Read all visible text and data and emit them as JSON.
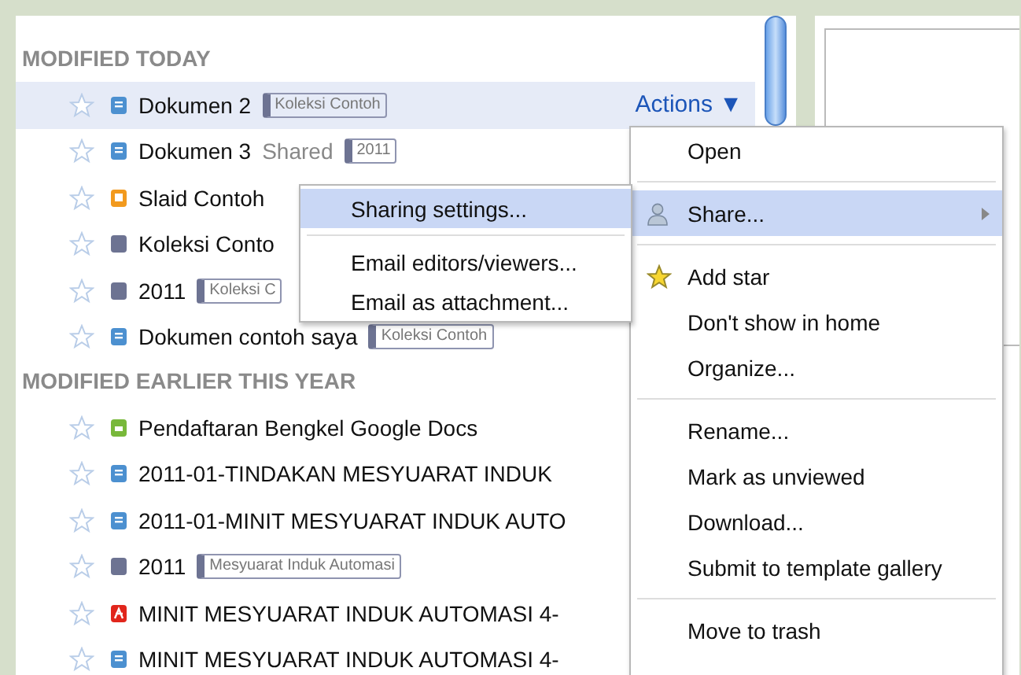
{
  "sections": [
    {
      "title": "MODIFIED TODAY",
      "rows": [
        {
          "name": "Dokumen 2",
          "kind": "document",
          "starred": false,
          "selected": true,
          "shared": "",
          "tags": [
            "Koleksi Contoh"
          ],
          "actions": "Actions ▼"
        },
        {
          "name": "Dokumen 3",
          "kind": "document",
          "starred": false,
          "selected": false,
          "shared": "Shared",
          "tags": [
            "2011"
          ]
        },
        {
          "name": "Slaid Contoh",
          "kind": "presentation",
          "starred": false,
          "selected": false,
          "tags": []
        },
        {
          "name": "Koleksi Conto",
          "kind": "collection",
          "starred": false,
          "selected": false,
          "tags": []
        },
        {
          "name": "2011",
          "kind": "collection",
          "starred": false,
          "selected": false,
          "tags": [
            "Koleksi C"
          ]
        },
        {
          "name": "Dokumen contoh saya",
          "kind": "document",
          "starred": false,
          "selected": false,
          "tags": [
            "Koleksi Contoh"
          ]
        }
      ]
    },
    {
      "title": "MODIFIED EARLIER THIS YEAR",
      "rows": [
        {
          "name": "Pendaftaran Bengkel Google Docs",
          "kind": "form",
          "starred": false,
          "selected": false,
          "tags": []
        },
        {
          "name": "2011-01-TINDAKAN MESYUARAT INDUK",
          "kind": "document",
          "starred": false,
          "selected": false,
          "tags": []
        },
        {
          "name": "2011-01-MINIT MESYUARAT INDUK AUTO",
          "kind": "document",
          "starred": false,
          "selected": false,
          "tags": []
        },
        {
          "name": "2011",
          "kind": "collection",
          "starred": false,
          "selected": false,
          "tags": [
            "Mesyuarat Induk Automasi"
          ]
        },
        {
          "name": "MINIT MESYUARAT INDUK AUTOMASI 4-",
          "kind": "pdf",
          "starred": false,
          "selected": false,
          "tags": []
        },
        {
          "name": "MINIT MESYUARAT INDUK AUTOMASI 4-",
          "kind": "document",
          "starred": false,
          "selected": false,
          "tags": []
        }
      ]
    }
  ],
  "actions_menu": [
    {
      "kind": "item",
      "label": "Open",
      "selected": false
    },
    {
      "kind": "separator"
    },
    {
      "kind": "share",
      "label": "Share...",
      "submenu": true,
      "selected": true
    },
    {
      "kind": "separator"
    },
    {
      "kind": "star",
      "label": "Add star",
      "selected": false
    },
    {
      "kind": "item",
      "label": "Don't show in home",
      "selected": false
    },
    {
      "kind": "item",
      "label": "Organize...",
      "selected": false
    },
    {
      "kind": "separator"
    },
    {
      "kind": "item",
      "label": "Rename...",
      "selected": false
    },
    {
      "kind": "item",
      "label": "Mark as unviewed",
      "selected": false
    },
    {
      "kind": "item",
      "label": "Download...",
      "selected": false
    },
    {
      "kind": "item",
      "label": "Submit to template gallery",
      "selected": false
    },
    {
      "kind": "separator"
    },
    {
      "kind": "item",
      "label": "Move to trash",
      "selected": false
    }
  ],
  "share_submenu": [
    {
      "kind": "item",
      "label": "Sharing settings...",
      "selected": true
    },
    {
      "kind": "separator"
    },
    {
      "kind": "item",
      "label": "Email editors/viewers...",
      "selected": false
    },
    {
      "kind": "item",
      "label": "Email as attachment...",
      "selected": false
    }
  ]
}
